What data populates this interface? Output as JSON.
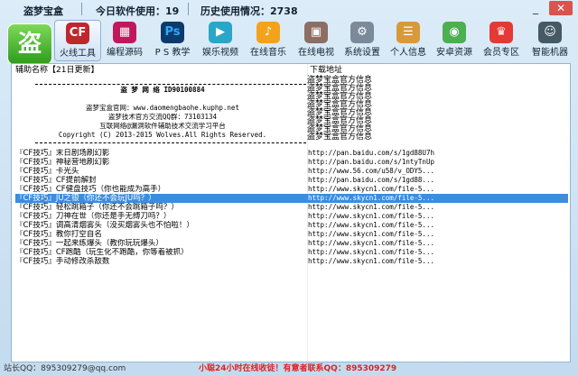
{
  "title": "盗梦宝盒",
  "today_label": "今日软件使用：19",
  "history_label": "历史使用情况：2738",
  "window_buttons": {
    "min": "_",
    "close": "✕"
  },
  "logo": "盗",
  "toolbar": [
    {
      "label": "火线工具",
      "icon": "CF",
      "color": "#c0272d"
    },
    {
      "label": "编程源码",
      "icon": "▦",
      "color": "#c2185b"
    },
    {
      "label": "P S 教学",
      "icon": "Ps",
      "color": "#0b3b6d"
    },
    {
      "label": "娱乐视频",
      "icon": "▶",
      "color": "#2aa6c9"
    },
    {
      "label": "在线音乐",
      "icon": "♪",
      "color": "#f3a31b"
    },
    {
      "label": "在线电视",
      "icon": "▣",
      "color": "#8d6e63"
    },
    {
      "label": "系统设置",
      "icon": "⚙",
      "color": "#7a8a99"
    },
    {
      "label": "个人信息",
      "icon": "☰",
      "color": "#d69a3a"
    },
    {
      "label": "安卓资源",
      "icon": "◉",
      "color": "#4caf50"
    },
    {
      "label": "会员专区",
      "icon": "♛",
      "color": "#e53935"
    },
    {
      "label": "智能机器",
      "icon": "☺",
      "color": "#455a64"
    }
  ],
  "list": {
    "col_name": "辅助名称【21日更新】",
    "col_url": "下载地址"
  },
  "banner": {
    "line1": "盗 梦 网 络 ID90100884",
    "line2": "盗梦宝盒官网：www.daomengbaohe.kuphp.net",
    "line3": "盗梦技术官方交流QQ群：73103134",
    "line4": "互联网络@漏洞软件辅助技术交流学习平台",
    "line5": "Copyright (C) 2013-2015 Wolves.All Rights Reserved."
  },
  "ads": [
    "盗梦宝盒官方信息",
    "盗梦宝盒官方信息",
    "盗梦宝盒官方信息",
    "盗梦宝盒官方信息",
    "盗梦宝盒官方信息",
    "盗梦宝盒官方信息",
    "盗梦宝盒官方信息",
    "盗梦宝盒官方信息"
  ],
  "rows": [
    {
      "title": "『CF技巧』末日剧场刷幻影",
      "url": "http://pan.baidu.com/s/1gd88U7h"
    },
    {
      "title": "『CF技巧』神秘营地刷幻影",
      "url": "http://pan.baidu.com/s/1ntyTnUp"
    },
    {
      "title": "『CF技巧』卡光头",
      "url": "http://www.56.com/u58/v_ODY5..."
    },
    {
      "title": "『CF技巧』CF提前解封",
      "url": "http://pan.baidu.com/s/1gd88..."
    },
    {
      "title": "『CF技巧』CF健盘技巧（你也能成为高手）",
      "url": "http://www.skycn1.com/file-5..."
    },
    {
      "title": "『CF技巧』JU之银（你还不会玩JU吗？）",
      "url": "http://www.skycn1.com/file-5..."
    },
    {
      "title": "『CF技巧』轻松跳箱子（你还不会跳箱子吗？）",
      "url": "http://www.skycn1.com/file-5..."
    },
    {
      "title": "『CF技巧』刀神在世（你还是手无缚刀吗？）",
      "url": "http://www.skycn1.com/file-5..."
    },
    {
      "title": "『CF技巧』调高清烟雾头（没买烟雾头也不怕啦！）",
      "url": "http://www.skycn1.com/file-5..."
    },
    {
      "title": "『CF技巧』教你打空自名",
      "url": "http://www.skycn1.com/file-5..."
    },
    {
      "title": "『CF技巧』一起来练爆头（教你玩玩爆头）",
      "url": "http://www.skycn1.com/file-5..."
    },
    {
      "title": "『CF技巧』CF跑酷（玩生化不跑酷，你等着被抓）",
      "url": "http://www.skycn1.com/file-5..."
    },
    {
      "title": "『CF技巧』手动修改杀敌数",
      "url": "http://www.skycn1.com/file-5..."
    }
  ],
  "selected_row": 5,
  "status": {
    "left": "站长QQ：895309279@qq.com",
    "center": "小聪24小时在线收徒！有意者联系QQ：895309279"
  }
}
